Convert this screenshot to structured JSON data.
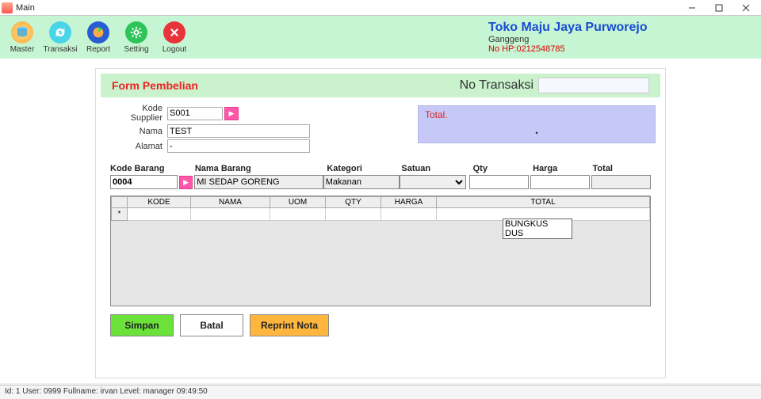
{
  "window": {
    "title": "Main"
  },
  "toolbar": {
    "master": "Master",
    "transaksi": "Transaksi",
    "report": "Report",
    "setting": "Setting",
    "logout": "Logout"
  },
  "company": {
    "name": "Toko Maju Jaya Purworejo",
    "location": "Ganggeng",
    "hp": "No HP:0212548785"
  },
  "form": {
    "title": "Form Pembelian",
    "no_transaksi_label": "No Transaksi",
    "no_transaksi_value": "",
    "supplier": {
      "kode_label": "Kode Supplier",
      "kode_value": "S001",
      "nama_label": "Nama",
      "nama_value": "TEST",
      "alamat_label": "Alamat",
      "alamat_value": "-"
    },
    "total": {
      "label": "Total.",
      "value": "."
    },
    "item_headers": {
      "kode": "Kode Barang",
      "nama": "Nama Barang",
      "kategori": "Kategori",
      "satuan": "Satuan",
      "qty": "Qty",
      "harga": "Harga",
      "total": "Total"
    },
    "item": {
      "kode": "0004",
      "nama": "MI SEDAP GORENG",
      "kategori": "Makanan",
      "satuan": "",
      "qty": "",
      "harga": "",
      "total": ""
    },
    "satuan_options": [
      "BUNGKUS",
      "DUS"
    ],
    "grid_headers": [
      "KODE",
      "NAMA",
      "UOM",
      "QTY",
      "HARGA",
      "TOTAL"
    ],
    "buttons": {
      "simpan": "Simpan",
      "batal": "Batal",
      "reprint": "Reprint Nota"
    }
  },
  "statusbar": "Id: 1 User: 0999 Fullname: irvan Level: manager 09:49:50"
}
